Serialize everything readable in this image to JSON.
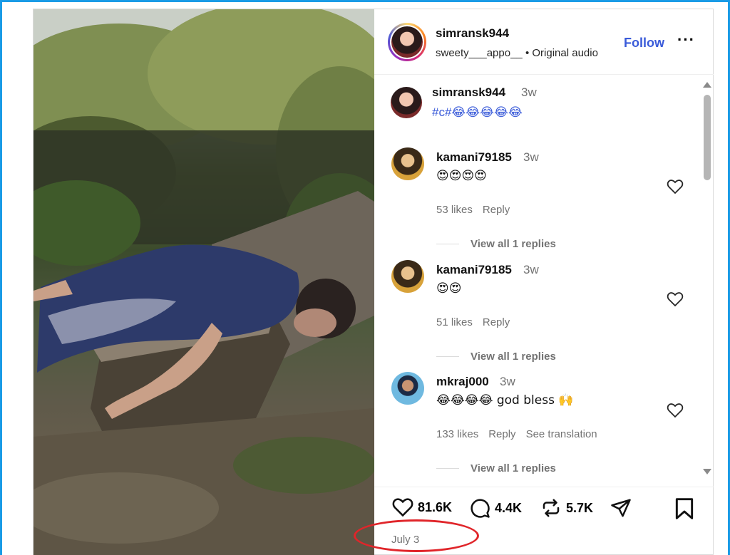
{
  "post": {
    "author": {
      "username": "simransk944",
      "audio_prefix": "sweety___appo__",
      "audio_sep": "•",
      "audio_label": "Original audio"
    },
    "follow_label": "Follow",
    "more_label": "···",
    "caption": {
      "username": "simransk944",
      "time": "3w",
      "hashtag": "#c#",
      "emojis": "😂😂😂😂😂"
    },
    "comments": [
      {
        "username": "kamani79185",
        "time": "3w",
        "text": "😍😍😍😍",
        "likes": "53 likes",
        "reply": "Reply",
        "translation": "",
        "view_replies": "View all 1 replies"
      },
      {
        "username": "kamani79185",
        "time": "3w",
        "text": "😍😍",
        "likes": "51 likes",
        "reply": "Reply",
        "translation": "",
        "view_replies": "View all 1 replies"
      },
      {
        "username": "mkraj000",
        "time": "3w",
        "text": "😂😂😂😂 god bless 🙌",
        "likes": "133 likes",
        "reply": "Reply",
        "translation": "See translation",
        "view_replies": "View all 1 replies"
      }
    ],
    "actions": {
      "likes": "81.6K",
      "comments": "4.4K",
      "reposts": "5.7K"
    },
    "date": "July 3",
    "colors": {
      "accent": "#3a5bd9",
      "muted": "#737373",
      "highlight_ring": "#e0252a",
      "frame_border": "#1a9be6"
    }
  }
}
